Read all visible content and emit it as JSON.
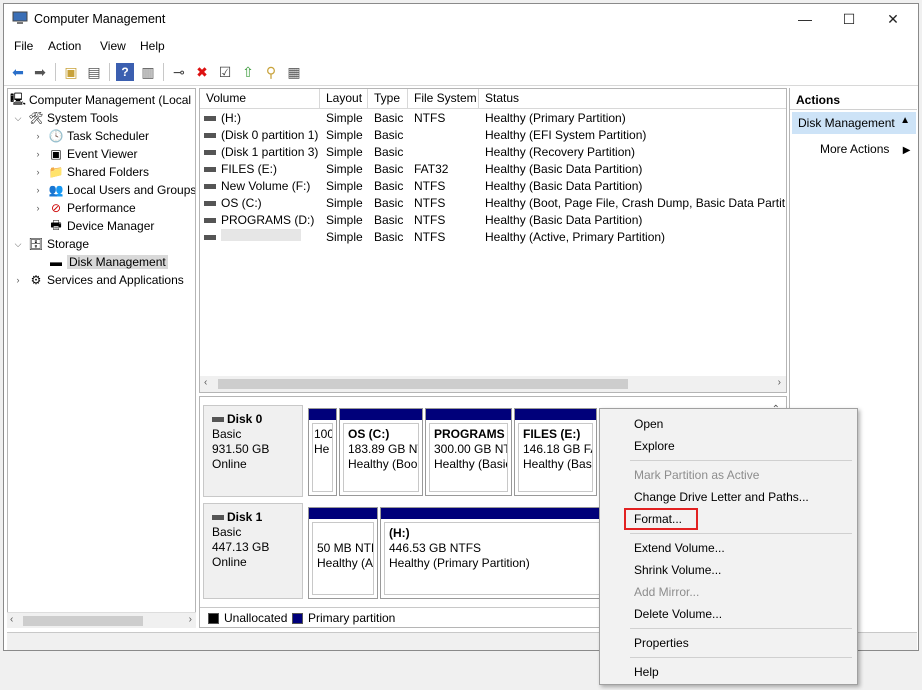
{
  "window": {
    "title": "Computer Management",
    "controls": {
      "minimize": "—",
      "maximize": "☐",
      "close": "✕"
    }
  },
  "menu": [
    "File",
    "Action",
    "View",
    "Help"
  ],
  "tree": {
    "root": "Computer Management (Local",
    "system_tools": "System Tools",
    "task_scheduler": "Task Scheduler",
    "event_viewer": "Event Viewer",
    "shared_folders": "Shared Folders",
    "local_users": "Local Users and Groups",
    "performance": "Performance",
    "device_manager": "Device Manager",
    "storage": "Storage",
    "disk_management": "Disk Management",
    "services": "Services and Applications"
  },
  "volumes": {
    "headers": [
      "Volume",
      "Layout",
      "Type",
      "File System",
      "Status"
    ],
    "rows": [
      {
        "volume": "(H:)",
        "layout": "Simple",
        "type": "Basic",
        "fs": "NTFS",
        "status": "Healthy (Primary Partition)"
      },
      {
        "volume": "(Disk 0 partition 1)",
        "layout": "Simple",
        "type": "Basic",
        "fs": "",
        "status": "Healthy (EFI System Partition)"
      },
      {
        "volume": "(Disk 1 partition 3)",
        "layout": "Simple",
        "type": "Basic",
        "fs": "",
        "status": "Healthy (Recovery Partition)"
      },
      {
        "volume": "FILES (E:)",
        "layout": "Simple",
        "type": "Basic",
        "fs": "FAT32",
        "status": "Healthy (Basic Data Partition)"
      },
      {
        "volume": "New Volume (F:)",
        "layout": "Simple",
        "type": "Basic",
        "fs": "NTFS",
        "status": "Healthy (Basic Data Partition)"
      },
      {
        "volume": "OS (C:)",
        "layout": "Simple",
        "type": "Basic",
        "fs": "NTFS",
        "status": "Healthy (Boot, Page File, Crash Dump, Basic Data Partitio"
      },
      {
        "volume": "PROGRAMS (D:)",
        "layout": "Simple",
        "type": "Basic",
        "fs": "NTFS",
        "status": "Healthy (Basic Data Partition)"
      },
      {
        "volume": "",
        "layout": "Simple",
        "type": "Basic",
        "fs": "NTFS",
        "status": "Healthy (Active, Primary Partition)"
      }
    ]
  },
  "disks": {
    "disk0": {
      "name": "Disk 0",
      "type": "Basic",
      "size": "931.50 GB",
      "state": "Online",
      "parts": [
        {
          "l1": "",
          "l2": "100",
          "l3": "He"
        },
        {
          "l1": "OS  (C:)",
          "l2": "183.89 GB NT",
          "l3": "Healthy (Boo"
        },
        {
          "l1": "PROGRAMS",
          "l2": "300.00 GB NTF",
          "l3": "Healthy (Basic"
        },
        {
          "l1": "FILES  (E:)",
          "l2": "146.18 GB FA",
          "l3": "Healthy (Basi"
        }
      ]
    },
    "disk1": {
      "name": "Disk 1",
      "type": "Basic",
      "size": "447.13 GB",
      "state": "Online",
      "parts": [
        {
          "l1": "",
          "l2": "50 MB NTF",
          "l3": "Healthy (A"
        },
        {
          "l1": "(H:)",
          "l2": "446.53 GB NTFS",
          "l3": "Healthy (Primary Partition)"
        }
      ]
    }
  },
  "legend": {
    "unallocated": "Unallocated",
    "primary": "Primary partition"
  },
  "actions": {
    "header": "Actions",
    "selected": "Disk Management",
    "more": "More Actions"
  },
  "context_menu": {
    "open": "Open",
    "explore": "Explore",
    "mark_active": "Mark Partition as Active",
    "change_letter": "Change Drive Letter and Paths...",
    "format": "Format...",
    "extend": "Extend Volume...",
    "shrink": "Shrink Volume...",
    "add_mirror": "Add Mirror...",
    "delete": "Delete Volume...",
    "properties": "Properties",
    "help": "Help"
  },
  "colors": {
    "primary_partition": "#00007a",
    "unallocated": "#000000",
    "highlight": "#e22222",
    "selected_action": "#cde3f7"
  }
}
